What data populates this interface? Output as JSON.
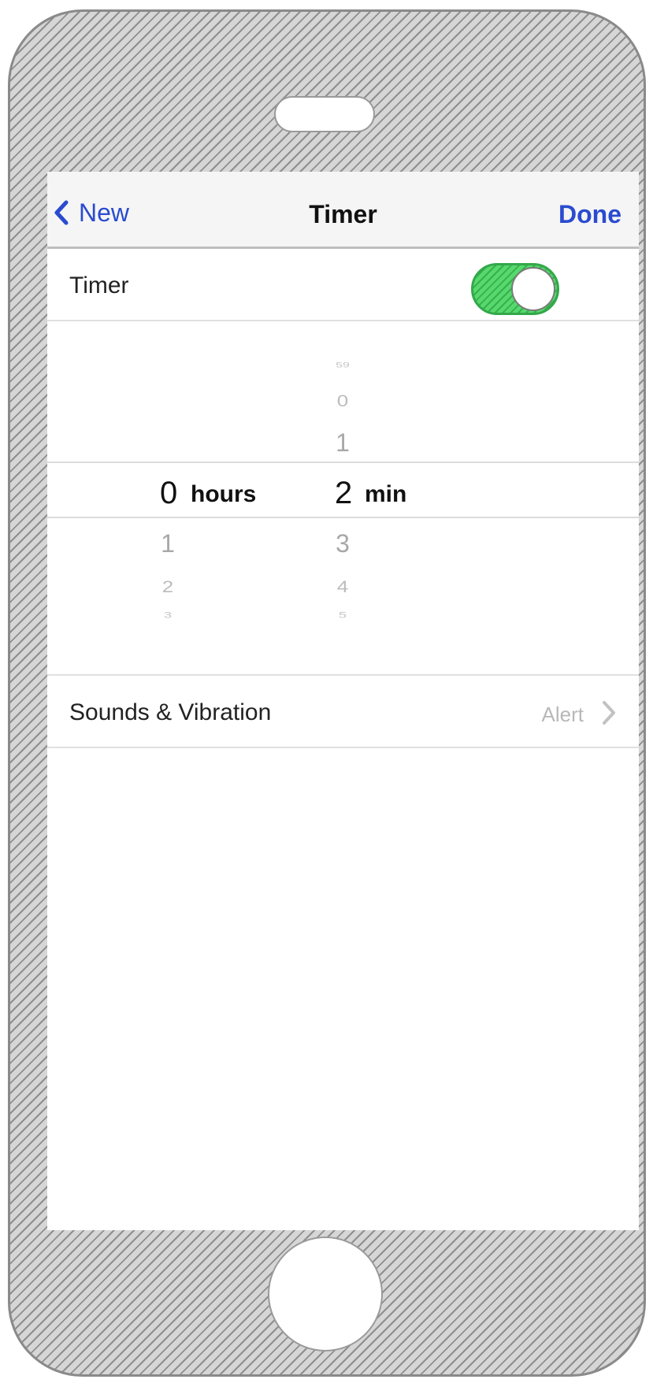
{
  "nav": {
    "back_label": "New",
    "title": "Timer",
    "done_label": "Done"
  },
  "timer_row": {
    "label": "Timer",
    "toggle_on": true
  },
  "picker": {
    "hours": {
      "above": [],
      "selected": "0",
      "unit": "hours",
      "below": [
        "1",
        "2",
        "3"
      ]
    },
    "minutes": {
      "above": [
        "59",
        "0",
        "1"
      ],
      "selected": "2",
      "unit": "min",
      "below": [
        "3",
        "4",
        "5"
      ]
    }
  },
  "sounds_row": {
    "label": "Sounds & Vibration",
    "value": "Alert"
  },
  "colors": {
    "accent": "#2a4bd0",
    "toggle_on": "#4fcf66"
  }
}
